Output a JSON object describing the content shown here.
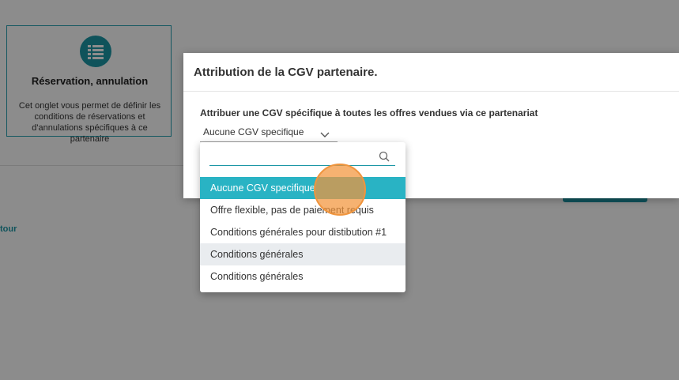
{
  "background": {
    "card": {
      "icon": "list-icon",
      "title": "Réservation, annulation",
      "description": "Cet onglet vous permet de définir les conditions de réservations et d'annulations spécifiques à ce partenaire"
    },
    "back_link": "tour"
  },
  "modal": {
    "title": "Attribution de la CGV partenaire.",
    "field_label": "Attribuer une CGV spécifique à toutes les offres vendues via ce partenariat",
    "select": {
      "value": "Aucune CGV specifique",
      "icon": "chevron-down-icon"
    }
  },
  "dropdown": {
    "search": {
      "value": "",
      "placeholder": "",
      "icon": "search-icon"
    },
    "options": [
      {
        "label": "Aucune CGV specifique",
        "state": "selected"
      },
      {
        "label": "Offre flexible, pas de paiement requis",
        "state": "normal"
      },
      {
        "label": "Conditions générales pour distibution #1",
        "state": "normal"
      },
      {
        "label": "Conditions générales",
        "state": "hovered"
      },
      {
        "label": "Conditions générales",
        "state": "normal"
      }
    ]
  },
  "colors": {
    "accent": "#1d97a6",
    "selected_option": "#29b3c4",
    "hover_option": "#e9ecef",
    "click_indicator": "#f0953e"
  }
}
